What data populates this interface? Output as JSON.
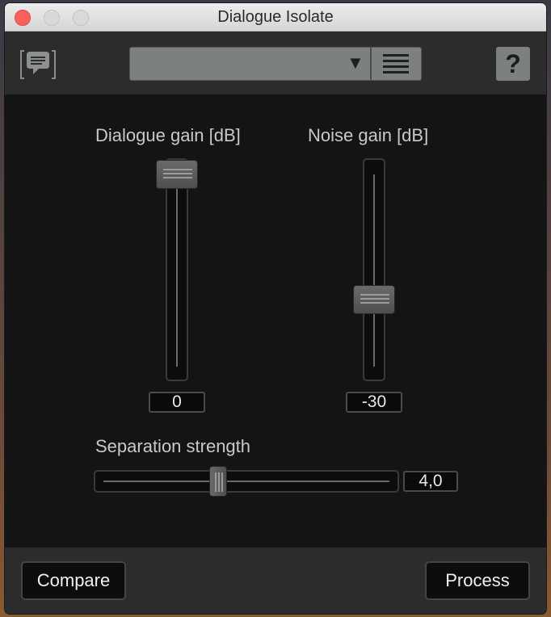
{
  "window": {
    "title": "Dialogue Isolate"
  },
  "header": {
    "chat_icon": "speech-bubble-icon",
    "preset": {
      "value": "",
      "arrow": "▼",
      "menu_icon": "hamburger-menu-icon"
    },
    "help_label": "?"
  },
  "main": {
    "dialogue_gain": {
      "label": "Dialogue gain [dB]",
      "value": "0",
      "level": 1.0
    },
    "noise_gain": {
      "label": "Noise gain [dB]",
      "value": "-30",
      "level": 0.35
    },
    "separation": {
      "label": "Separation strength",
      "value": "4,0",
      "level": 0.4
    }
  },
  "footer": {
    "compare_label": "Compare",
    "process_label": "Process"
  }
}
